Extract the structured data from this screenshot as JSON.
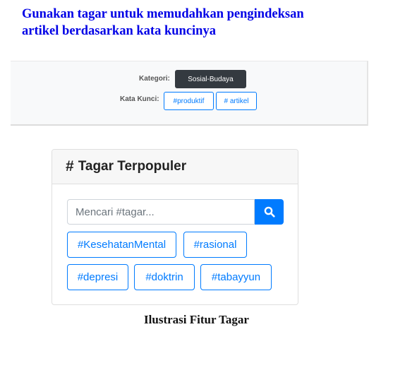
{
  "heading": {
    "line1": "Gunakan tagar untuk memudahkan pengindeksan",
    "line2": "artikel berdasarkan kata kuncinya"
  },
  "meta": {
    "category_label": "Kategori:",
    "category_value": "Sosial-Budaya",
    "keywords_label": "Kata Kunci:",
    "keywords": [
      "#produktif",
      "# artikel"
    ]
  },
  "widget": {
    "title": "Tagar Terpopuler",
    "title_icon": "hash-icon",
    "search_placeholder": "Mencari #tagar...",
    "search_icon": "search-icon",
    "tags": [
      "#KesehatanMental",
      "#rasional",
      "#depresi",
      "#doktrin",
      "#tabayyun"
    ]
  },
  "caption": "Ilustrasi Fitur Tagar",
  "colors": {
    "heading": "#0000e6",
    "primary": "#007bff",
    "badge_dark": "#343a40"
  }
}
